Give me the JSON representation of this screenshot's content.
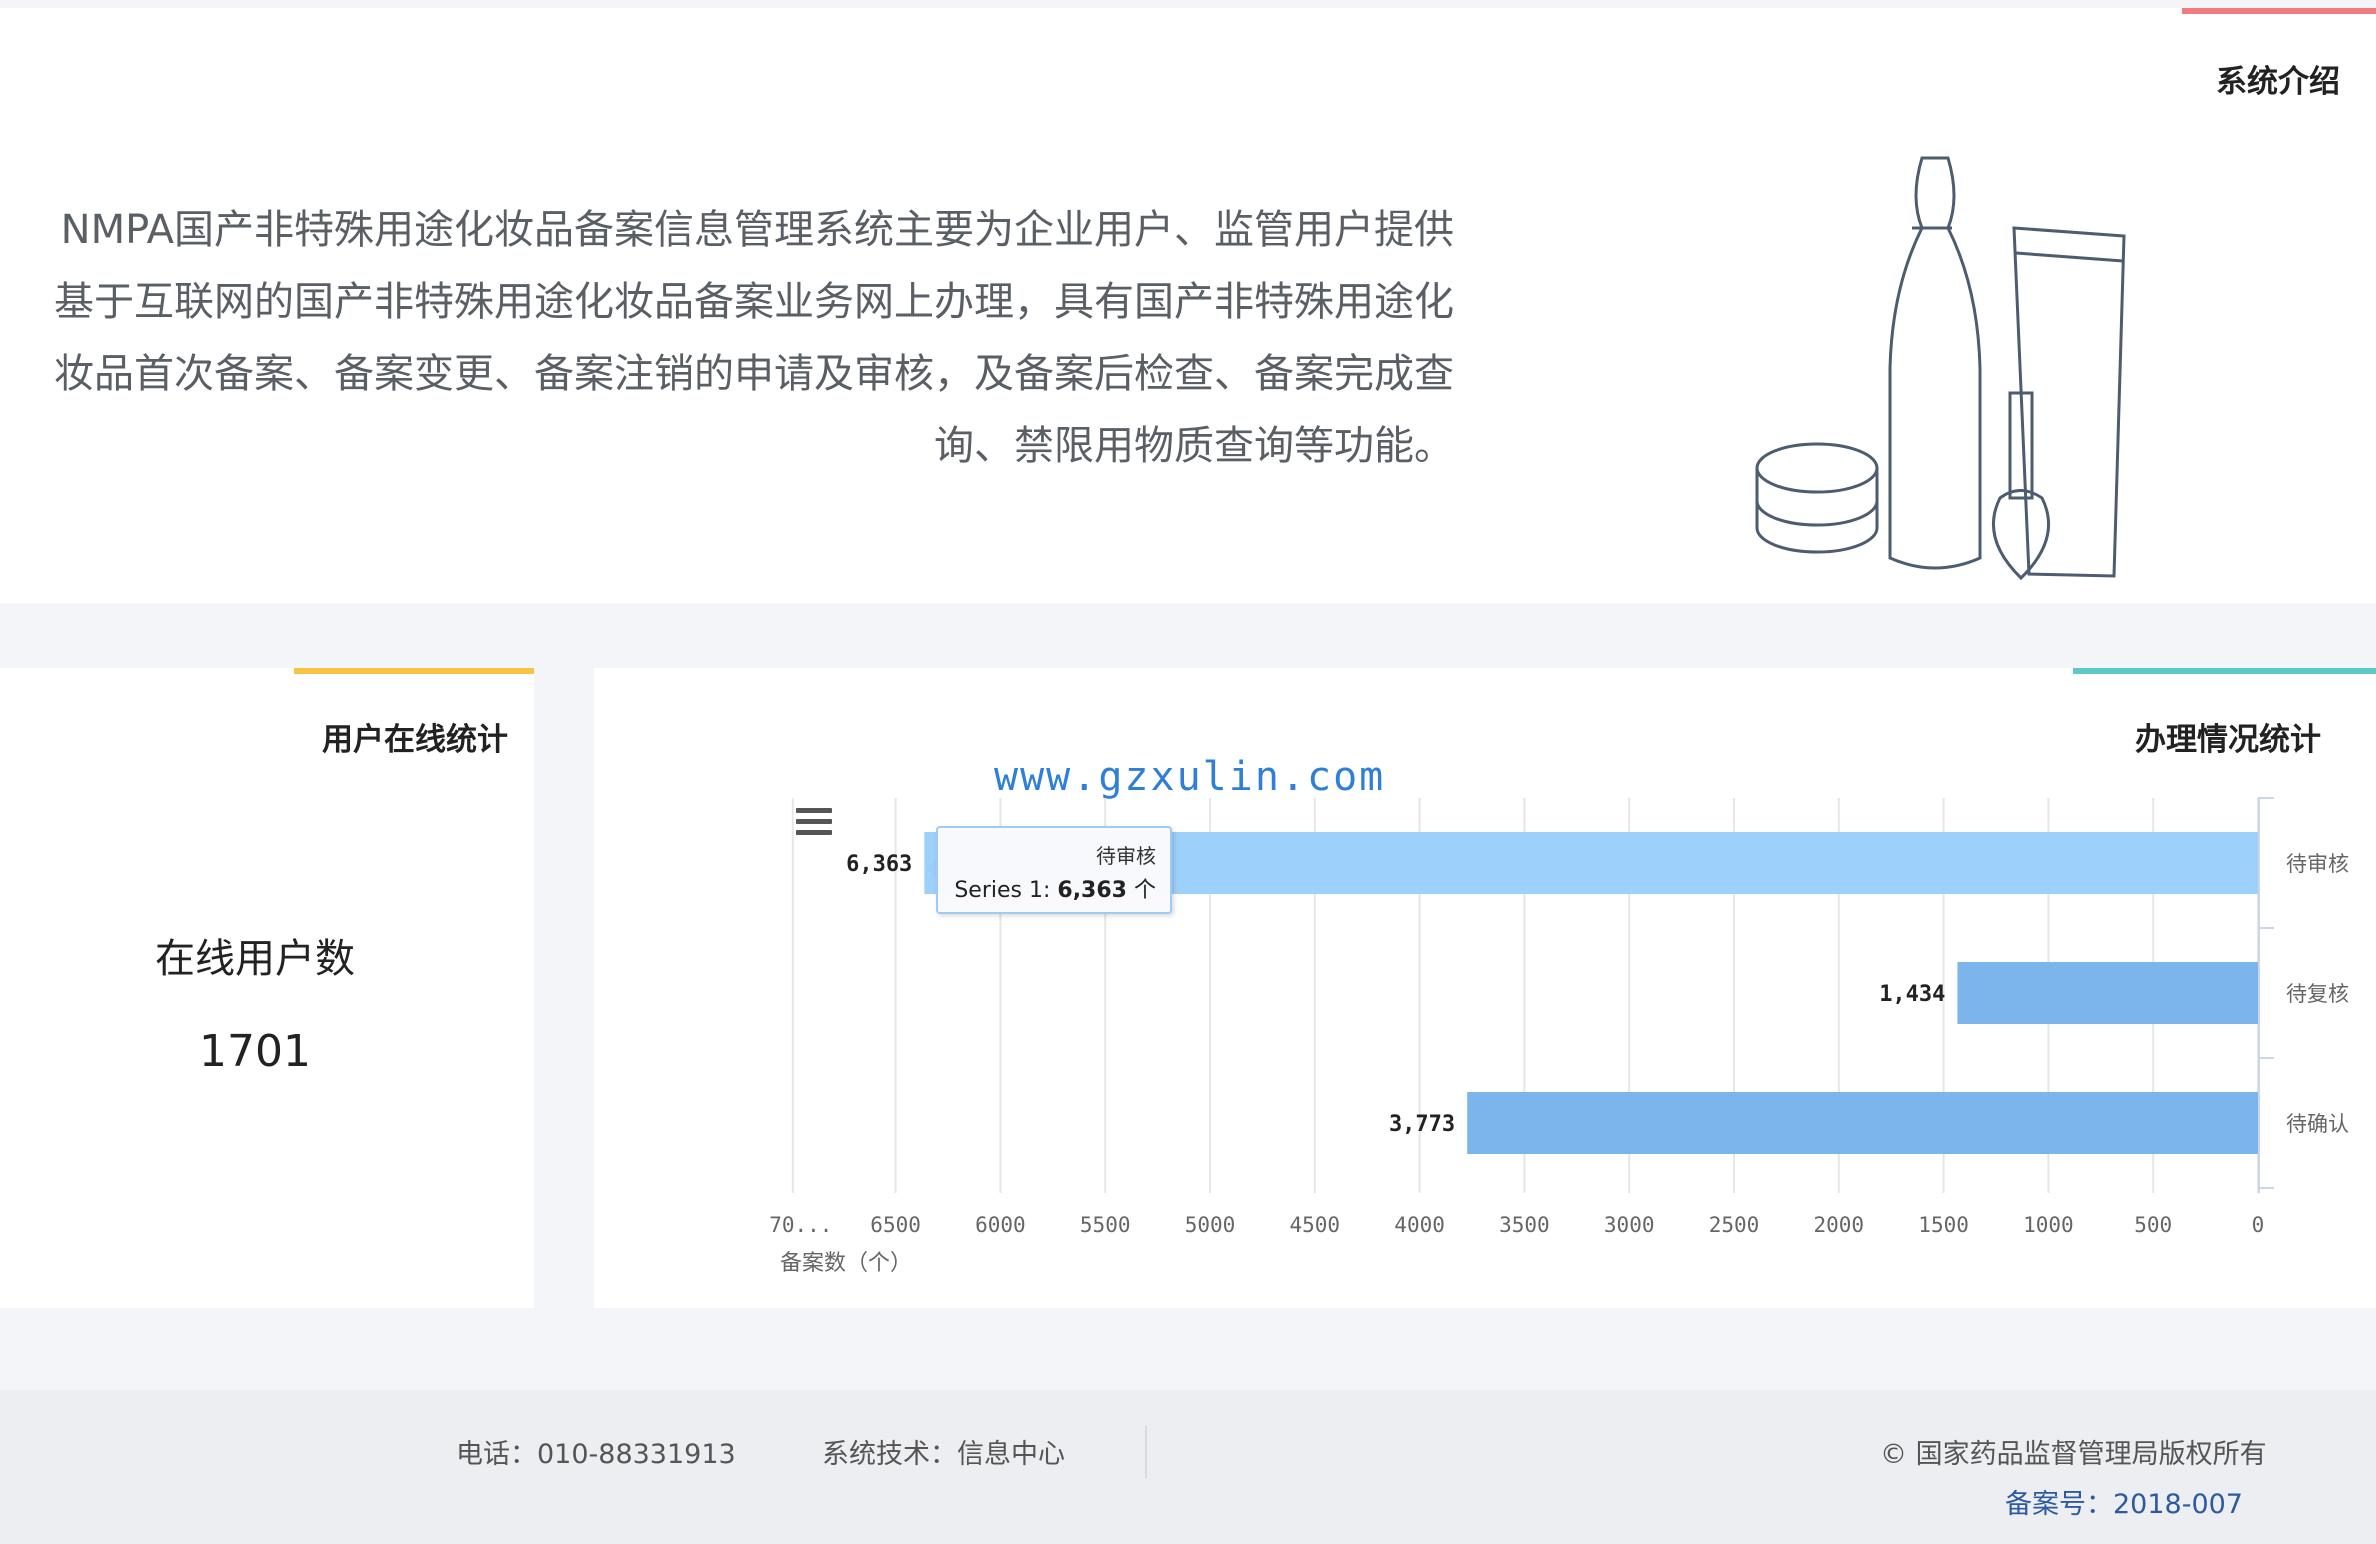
{
  "intro": {
    "title": "系统介绍",
    "text": "NMPA国产非特殊用途化妆品备案信息管理系统主要为企业用户、监管用户提供基于互联网的国产非特殊用途化妆品备案业务网上办理，具有国产非特殊用途化妆品首次备案、备案变更、备案注销的申请及审核，及备案后检查、备案完成查询、禁限用物质查询等功能。"
  },
  "users": {
    "title": "用户在线统计",
    "label": "在线用户数",
    "value": "1701"
  },
  "stats": {
    "title": "办理情况统计",
    "watermark": "www.gzxulin.com",
    "menu_icon": "hamburger-menu-icon",
    "tooltip": {
      "category": "待审核",
      "series": "Series 1",
      "value": "6,363",
      "unit": "个"
    }
  },
  "chart_data": {
    "type": "bar",
    "orientation": "horizontal",
    "mirrored": true,
    "categories": [
      "待审核",
      "待复核",
      "待确认"
    ],
    "values": [
      6363,
      1434,
      3773
    ],
    "data_labels": [
      "6,363",
      "1,434",
      "3,773"
    ],
    "colors": [
      "#9dd0fb",
      "#7cb5ec",
      "#7cb5ec"
    ],
    "xlim": [
      0,
      7000
    ],
    "x_ticks": [
      0,
      500,
      1000,
      1500,
      2000,
      2500,
      3000,
      3500,
      4000,
      4500,
      5000,
      5500,
      6000,
      6500
    ],
    "x_tick_labels": [
      "0",
      "500",
      "1000",
      "1500",
      "2000",
      "2500",
      "3000",
      "3500",
      "4000",
      "4500",
      "5000",
      "5500",
      "6000",
      "6500",
      "70..."
    ],
    "xlabel": "备案数（个）",
    "grid": true
  },
  "footer": {
    "copyright": "© 国家药品监督管理局版权所有",
    "record": "备案号：2018-007",
    "tech": "系统技术：信息中心",
    "phone": "电话：010-88331913"
  },
  "colors": {
    "intro_accent": "#f07c82",
    "users_accent": "#f6c343",
    "stats_accent": "#5cc8c8",
    "bar_highlight": "#9dd0fb",
    "bar": "#7cb5ec"
  }
}
